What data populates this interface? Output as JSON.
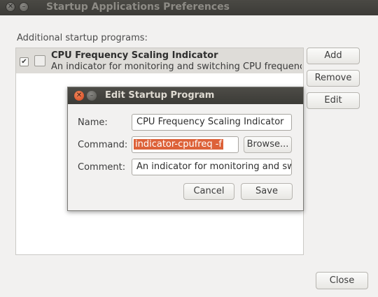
{
  "window": {
    "title": "Startup Applications Preferences"
  },
  "main": {
    "label": "Additional startup programs:",
    "items": [
      {
        "title": "CPU Frequency Scaling Indicator",
        "description": "An indicator for monitoring and switching CPU frequency …",
        "checked": true
      }
    ],
    "buttons": {
      "add": "Add",
      "remove": "Remove",
      "edit": "Edit",
      "close": "Close"
    }
  },
  "dialog": {
    "title": "Edit Startup Program",
    "name_label": "Name:",
    "name_value": "CPU Frequency Scaling Indicator",
    "command_label": "Command:",
    "command_value": "indicator-cpufreq -f",
    "browse_label": "Browse...",
    "comment_label": "Comment:",
    "comment_value": "An indicator for monitoring and swit",
    "cancel_label": "Cancel",
    "save_label": "Save"
  },
  "colors": {
    "selection": "#dd6239",
    "close_button": "#e05a2a",
    "titlebar": "#3c3b37"
  },
  "icons": {
    "checkbox": "check-icon",
    "app": "application-icon"
  }
}
